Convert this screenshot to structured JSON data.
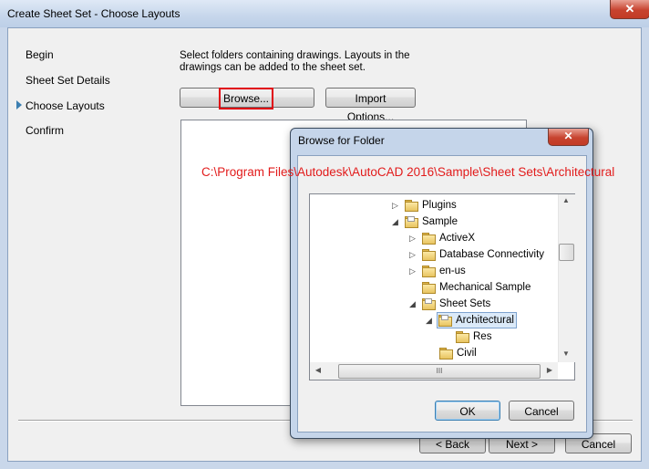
{
  "window": {
    "title": "Create Sheet Set - Choose Layouts",
    "close_label": "✕"
  },
  "nav": {
    "items": [
      {
        "label": "Begin"
      },
      {
        "label": "Sheet Set Details"
      },
      {
        "label": "Choose Layouts",
        "current": true
      },
      {
        "label": "Confirm"
      }
    ]
  },
  "main": {
    "description_line1": "Select folders containing drawings.  Layouts in the",
    "description_line2": "drawings can be added to the sheet set.",
    "browse_label": "Browse...",
    "import_options_label": "Import Options..."
  },
  "footer": {
    "back_label": "< Back",
    "next_label": "Next >",
    "cancel_label": "Cancel"
  },
  "annotation": {
    "path": "C:\\Program Files\\Autodesk\\AutoCAD 2016\\Sample\\Sheet Sets\\Architectural",
    "color": "#e21b1b"
  },
  "browse_dialog": {
    "title": "Browse for Folder",
    "close_label": "✕",
    "tree": [
      {
        "label": "Plugins",
        "expander": "▷"
      },
      {
        "label": "Sample",
        "expander": "◢"
      },
      {
        "label": "ActiveX",
        "expander": "▷"
      },
      {
        "label": "Database Connectivity",
        "expander": "▷"
      },
      {
        "label": "en-us",
        "expander": "▷"
      },
      {
        "label": "Mechanical Sample",
        "expander": ""
      },
      {
        "label": "Sheet Sets",
        "expander": "◢"
      },
      {
        "label": "Architectural",
        "expander": "◢",
        "selected": true
      },
      {
        "label": "Res",
        "expander": ""
      },
      {
        "label": "Civil",
        "expander": ""
      }
    ],
    "scroll_grip": "III",
    "ok_label": "OK",
    "cancel_label": "Cancel"
  },
  "icons": {
    "scroll_up": "▲",
    "scroll_down": "▼",
    "scroll_left": "◀",
    "scroll_right": "▶"
  }
}
